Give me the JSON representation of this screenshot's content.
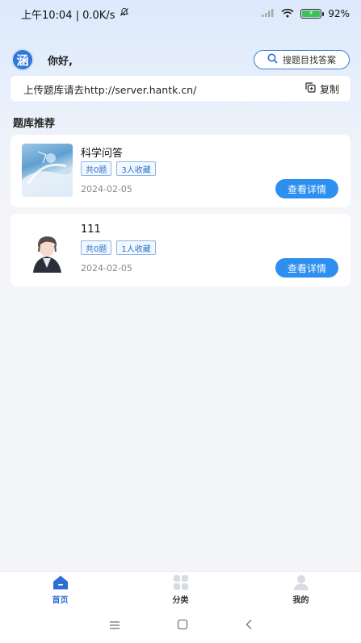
{
  "status_bar": {
    "time_and_speed": "上午10:04 | 0.0K/s",
    "battery": "92%",
    "battery_level": 0.92
  },
  "header": {
    "logo_char": "涵",
    "greeting": "你好,",
    "search_label": "搜题目找答案"
  },
  "upload": {
    "text": "上传题库请去http://server.hantk.cn/",
    "copy_label": "复制"
  },
  "section": {
    "title": "题库推荐"
  },
  "banks": [
    {
      "title": "科学问答",
      "questions": "共0题",
      "favorites": "3人收藏",
      "date": "2024-02-05",
      "button": "查看详情"
    },
    {
      "title": "111",
      "questions": "共0题",
      "favorites": "1人收藏",
      "date": "2024-02-05",
      "button": "查看详情"
    }
  ],
  "tabs": [
    {
      "label": "首页",
      "icon": "home-icon",
      "active": true
    },
    {
      "label": "分类",
      "icon": "grid-icon",
      "active": false
    },
    {
      "label": "我的",
      "icon": "person-icon",
      "active": false
    }
  ],
  "colors": {
    "accent": "#2d8ff0",
    "brand": "#2f78d9"
  }
}
